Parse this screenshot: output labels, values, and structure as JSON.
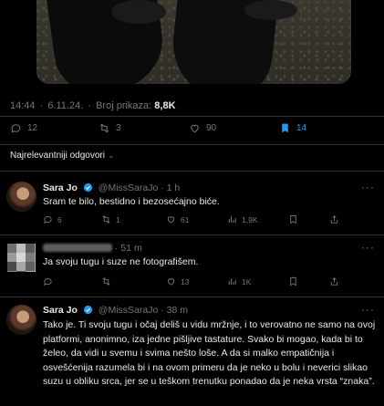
{
  "post": {
    "time": "14:44",
    "date": "6.11.24.",
    "views_label": "Broj prikaza:",
    "views_value": "8,8K",
    "actions": {
      "replies": "12",
      "reposts": "3",
      "likes": "90",
      "bookmarks": "14"
    }
  },
  "sort_label": "Najrelevantniji odgovori",
  "replies": [
    {
      "name": "Sara Jo",
      "handle": "@MissSaraJo",
      "time": "1 h",
      "text": "Sram te bilo, bestidno i bezosećajno biće.",
      "stats": {
        "replies": "6",
        "reposts": "1",
        "likes": "61",
        "views": "1,9K"
      }
    },
    {
      "name": "",
      "handle": "",
      "time": "51 m",
      "text": "Ja svoju tugu i suze ne fotografišem.",
      "stats": {
        "replies": "",
        "reposts": "",
        "likes": "13",
        "views": "1K"
      }
    },
    {
      "name": "Sara Jo",
      "handle": "@MissSaraJo",
      "time": "38 m",
      "text": "Tako je. Ti svoju tugu i očaj deliš u vidu mržnje, i to verovatno ne samo na ovoj platformi, anonimno, iza jedne pišljive tastature. Svako bi mogao, kada bi to želeo, da vidi u svemu i svima nešto loše. A da si malko empatičnija i osvešćenija razumela bi i na ovom primeru da je neko u bolu i neverici slikao suzu u obliku srca, jer se u teškom trenutku ponadao da je neka vrsta “znaka”."
    }
  ],
  "colors": {
    "accent": "#1d9bf0",
    "muted": "#71767b",
    "text": "#e7e9ea",
    "border": "#2f3336"
  }
}
